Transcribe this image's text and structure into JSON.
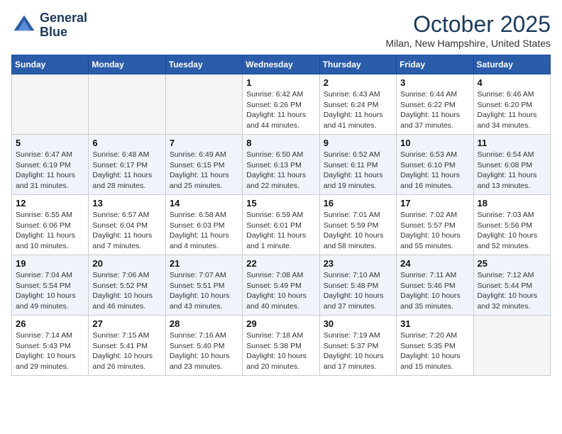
{
  "header": {
    "logo_line1": "General",
    "logo_line2": "Blue",
    "month": "October 2025",
    "location": "Milan, New Hampshire, United States"
  },
  "days_of_week": [
    "Sunday",
    "Monday",
    "Tuesday",
    "Wednesday",
    "Thursday",
    "Friday",
    "Saturday"
  ],
  "weeks": [
    [
      {
        "day": "",
        "sunrise": "",
        "sunset": "",
        "daylight": ""
      },
      {
        "day": "",
        "sunrise": "",
        "sunset": "",
        "daylight": ""
      },
      {
        "day": "",
        "sunrise": "",
        "sunset": "",
        "daylight": ""
      },
      {
        "day": "1",
        "sunrise": "Sunrise: 6:42 AM",
        "sunset": "Sunset: 6:26 PM",
        "daylight": "Daylight: 11 hours and 44 minutes."
      },
      {
        "day": "2",
        "sunrise": "Sunrise: 6:43 AM",
        "sunset": "Sunset: 6:24 PM",
        "daylight": "Daylight: 11 hours and 41 minutes."
      },
      {
        "day": "3",
        "sunrise": "Sunrise: 6:44 AM",
        "sunset": "Sunset: 6:22 PM",
        "daylight": "Daylight: 11 hours and 37 minutes."
      },
      {
        "day": "4",
        "sunrise": "Sunrise: 6:46 AM",
        "sunset": "Sunset: 6:20 PM",
        "daylight": "Daylight: 11 hours and 34 minutes."
      }
    ],
    [
      {
        "day": "5",
        "sunrise": "Sunrise: 6:47 AM",
        "sunset": "Sunset: 6:19 PM",
        "daylight": "Daylight: 11 hours and 31 minutes."
      },
      {
        "day": "6",
        "sunrise": "Sunrise: 6:48 AM",
        "sunset": "Sunset: 6:17 PM",
        "daylight": "Daylight: 11 hours and 28 minutes."
      },
      {
        "day": "7",
        "sunrise": "Sunrise: 6:49 AM",
        "sunset": "Sunset: 6:15 PM",
        "daylight": "Daylight: 11 hours and 25 minutes."
      },
      {
        "day": "8",
        "sunrise": "Sunrise: 6:50 AM",
        "sunset": "Sunset: 6:13 PM",
        "daylight": "Daylight: 11 hours and 22 minutes."
      },
      {
        "day": "9",
        "sunrise": "Sunrise: 6:52 AM",
        "sunset": "Sunset: 6:11 PM",
        "daylight": "Daylight: 11 hours and 19 minutes."
      },
      {
        "day": "10",
        "sunrise": "Sunrise: 6:53 AM",
        "sunset": "Sunset: 6:10 PM",
        "daylight": "Daylight: 11 hours and 16 minutes."
      },
      {
        "day": "11",
        "sunrise": "Sunrise: 6:54 AM",
        "sunset": "Sunset: 6:08 PM",
        "daylight": "Daylight: 11 hours and 13 minutes."
      }
    ],
    [
      {
        "day": "12",
        "sunrise": "Sunrise: 6:55 AM",
        "sunset": "Sunset: 6:06 PM",
        "daylight": "Daylight: 11 hours and 10 minutes."
      },
      {
        "day": "13",
        "sunrise": "Sunrise: 6:57 AM",
        "sunset": "Sunset: 6:04 PM",
        "daylight": "Daylight: 11 hours and 7 minutes."
      },
      {
        "day": "14",
        "sunrise": "Sunrise: 6:58 AM",
        "sunset": "Sunset: 6:03 PM",
        "daylight": "Daylight: 11 hours and 4 minutes."
      },
      {
        "day": "15",
        "sunrise": "Sunrise: 6:59 AM",
        "sunset": "Sunset: 6:01 PM",
        "daylight": "Daylight: 11 hours and 1 minute."
      },
      {
        "day": "16",
        "sunrise": "Sunrise: 7:01 AM",
        "sunset": "Sunset: 5:59 PM",
        "daylight": "Daylight: 10 hours and 58 minutes."
      },
      {
        "day": "17",
        "sunrise": "Sunrise: 7:02 AM",
        "sunset": "Sunset: 5:57 PM",
        "daylight": "Daylight: 10 hours and 55 minutes."
      },
      {
        "day": "18",
        "sunrise": "Sunrise: 7:03 AM",
        "sunset": "Sunset: 5:56 PM",
        "daylight": "Daylight: 10 hours and 52 minutes."
      }
    ],
    [
      {
        "day": "19",
        "sunrise": "Sunrise: 7:04 AM",
        "sunset": "Sunset: 5:54 PM",
        "daylight": "Daylight: 10 hours and 49 minutes."
      },
      {
        "day": "20",
        "sunrise": "Sunrise: 7:06 AM",
        "sunset": "Sunset: 5:52 PM",
        "daylight": "Daylight: 10 hours and 46 minutes."
      },
      {
        "day": "21",
        "sunrise": "Sunrise: 7:07 AM",
        "sunset": "Sunset: 5:51 PM",
        "daylight": "Daylight: 10 hours and 43 minutes."
      },
      {
        "day": "22",
        "sunrise": "Sunrise: 7:08 AM",
        "sunset": "Sunset: 5:49 PM",
        "daylight": "Daylight: 10 hours and 40 minutes."
      },
      {
        "day": "23",
        "sunrise": "Sunrise: 7:10 AM",
        "sunset": "Sunset: 5:48 PM",
        "daylight": "Daylight: 10 hours and 37 minutes."
      },
      {
        "day": "24",
        "sunrise": "Sunrise: 7:11 AM",
        "sunset": "Sunset: 5:46 PM",
        "daylight": "Daylight: 10 hours and 35 minutes."
      },
      {
        "day": "25",
        "sunrise": "Sunrise: 7:12 AM",
        "sunset": "Sunset: 5:44 PM",
        "daylight": "Daylight: 10 hours and 32 minutes."
      }
    ],
    [
      {
        "day": "26",
        "sunrise": "Sunrise: 7:14 AM",
        "sunset": "Sunset: 5:43 PM",
        "daylight": "Daylight: 10 hours and 29 minutes."
      },
      {
        "day": "27",
        "sunrise": "Sunrise: 7:15 AM",
        "sunset": "Sunset: 5:41 PM",
        "daylight": "Daylight: 10 hours and 26 minutes."
      },
      {
        "day": "28",
        "sunrise": "Sunrise: 7:16 AM",
        "sunset": "Sunset: 5:40 PM",
        "daylight": "Daylight: 10 hours and 23 minutes."
      },
      {
        "day": "29",
        "sunrise": "Sunrise: 7:18 AM",
        "sunset": "Sunset: 5:38 PM",
        "daylight": "Daylight: 10 hours and 20 minutes."
      },
      {
        "day": "30",
        "sunrise": "Sunrise: 7:19 AM",
        "sunset": "Sunset: 5:37 PM",
        "daylight": "Daylight: 10 hours and 17 minutes."
      },
      {
        "day": "31",
        "sunrise": "Sunrise: 7:20 AM",
        "sunset": "Sunset: 5:35 PM",
        "daylight": "Daylight: 10 hours and 15 minutes."
      },
      {
        "day": "",
        "sunrise": "",
        "sunset": "",
        "daylight": ""
      }
    ]
  ]
}
